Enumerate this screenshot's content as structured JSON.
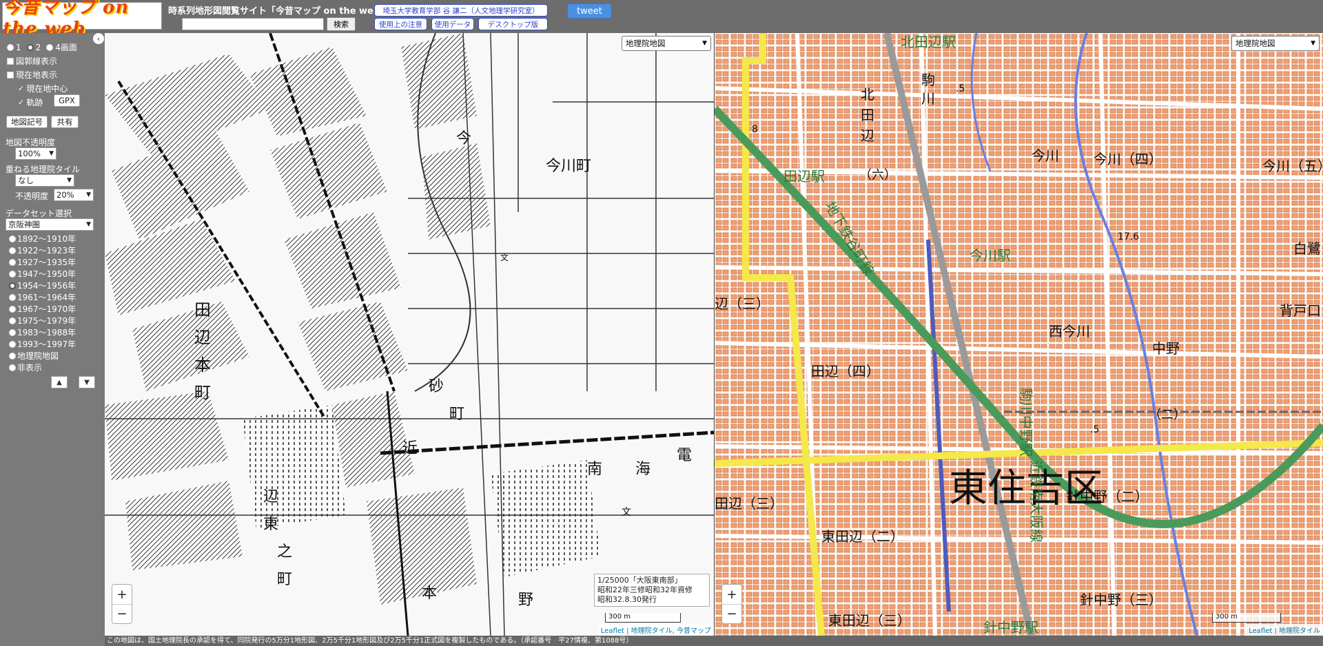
{
  "header": {
    "logo_text": "今昔マップ on the web",
    "site_title": "時系列地形図閲覧サイト「今昔マップ on the web」",
    "search_placeholder": "",
    "search_button": "検索",
    "author_link": "埼玉大学教育学部 谷 謙二（人文地理学研究室）",
    "notes_link": "使用上の注意",
    "data_link": "使用データ",
    "desktop_link": "デスクトップ版",
    "tweet": "tweet"
  },
  "sidebar": {
    "screen_options": [
      "1",
      "2",
      "4画面"
    ],
    "screen_selected": "2",
    "border_label": "図郭線表示",
    "location_label": "現在地表示",
    "center_label": "現在地中心",
    "track_label": "軌跡",
    "gpx_button": "GPX",
    "legend_button": "地図記号",
    "share_button": "共有",
    "opacity_label": "地図不透明度",
    "opacity_value": "100%",
    "overlay_label": "重ねる地理院タイル",
    "overlay_value": "なし",
    "overlay_opacity_label": "不透明度",
    "overlay_opacity_value": "20%",
    "dataset_label": "データセット選択",
    "dataset_value": "京阪神圏",
    "periods": [
      "1892～1910年",
      "1922～1923年",
      "1927～1935年",
      "1947～1950年",
      "1954～1956年",
      "1961～1964年",
      "1967～1970年",
      "1975～1979年",
      "1983～1988年",
      "1993～1997年",
      "地理院地図",
      "非表示"
    ],
    "selected_period": "1954～1956年",
    "up_arrow": "▲",
    "down_arrow": "▼",
    "collapse": "‹"
  },
  "old_map": {
    "layer_select": "地理院地図",
    "info_line1": "1/25000「大阪東南部」",
    "info_line2": "昭和22年三修昭和32年資修",
    "info_line3": "昭和32.8.30発行",
    "scale": "300 m",
    "zoom_in": "+",
    "zoom_out": "−",
    "attribution": "Leaflet | 地理院タイル, 今昔マップ",
    "labels": [
      "今",
      "今川町",
      "田",
      "辺",
      "本",
      "町",
      "砂",
      "近",
      "南",
      "海",
      "電",
      "町",
      "辺",
      "東",
      "之",
      "町",
      "本",
      "野",
      "文",
      "文"
    ]
  },
  "new_map": {
    "layer_select": "地理院地図",
    "scale": "300 m",
    "zoom_in": "+",
    "zoom_out": "−",
    "attribution": "Leaflet | 地理院タイル",
    "labels": {
      "kita_tanabe_station": "北田辺駅",
      "koma": "駒",
      "kawa": "川",
      "kita": "北",
      "ta": "田",
      "be": "辺",
      "roku": "（六）",
      "tanabe_station": "田辺駅",
      "subway_line": "地下鉄谷町線",
      "imagawa_station": "今川駅",
      "imagawa_4": "今川（四）",
      "imagawa_v": "今川",
      "imagawa_5": "今川（五）",
      "tanabe_3": "辺（三）",
      "tanabe_4": "田辺（四）",
      "nishi_imagawa": "西今川",
      "komagawa_nakano": "駒川中野駅",
      "higashi_sumiyoshi": "東住吉区",
      "kintetsu": "近鉄南大阪線",
      "harinakano_2": "針中野（二）",
      "harinakano_3": "針中野（三）",
      "higashi_tanabe_2": "東田辺（二）",
      "higashi_tanabe_3": "東田辺（三）",
      "tanabe_3b": "田辺（三）",
      "harinakano_station": "針中野駅",
      "nakano": "中野",
      "nakano_2": "（二）",
      "sedoguchi": "背戸口",
      "shirasagi": "白鷺",
      "elev1": "17.6",
      "elev2": ".5",
      "elev3": ".5",
      "elev4": "8"
    }
  },
  "footer": "この地図は、国土地理院長の承認を得て、同院発行の5万分1地形図、2万5千分1地形図及び2万5千分1正式図を複製したものである。（承認番号　平27情複、第1088号）"
}
